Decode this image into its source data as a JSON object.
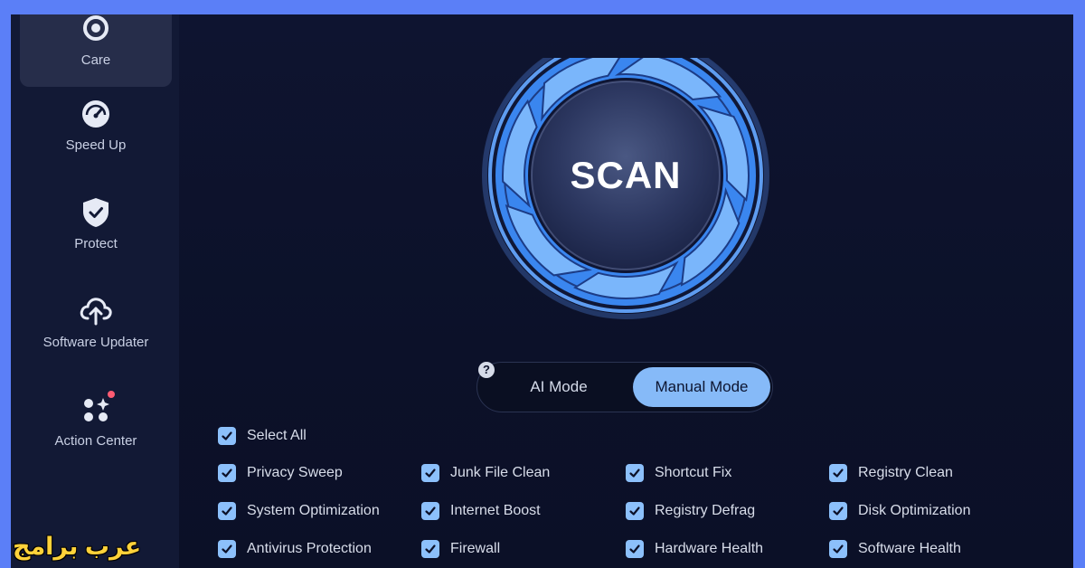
{
  "sidebar": {
    "items": [
      {
        "label": "Care",
        "icon": "care-icon",
        "active": true
      },
      {
        "label": "Speed Up",
        "icon": "speedometer-icon"
      },
      {
        "label": "Protect",
        "icon": "shield-icon"
      },
      {
        "label": "Software Updater",
        "icon": "cloud-upload-icon"
      },
      {
        "label": "Action Center",
        "icon": "apps-grid-icon",
        "badge": true
      }
    ]
  },
  "scan": {
    "label": "SCAN"
  },
  "modes": {
    "ai": "AI Mode",
    "manual": "Manual Mode",
    "selected": "Manual Mode",
    "help": "?"
  },
  "options": {
    "select_all": "Select All",
    "items": [
      "Privacy Sweep",
      "Junk File Clean",
      "Shortcut Fix",
      "Registry Clean",
      "System Optimization",
      "Internet Boost",
      "Registry Defrag",
      "Disk Optimization",
      "Antivirus Protection",
      "Firewall",
      "Hardware Health",
      "Software Health"
    ],
    "checked": true
  },
  "watermark": "عرب برامج",
  "colors": {
    "accent": "#86baf8",
    "background": "#0c1129",
    "frame": "#5b7ff7",
    "badge": "#ff5b72"
  }
}
